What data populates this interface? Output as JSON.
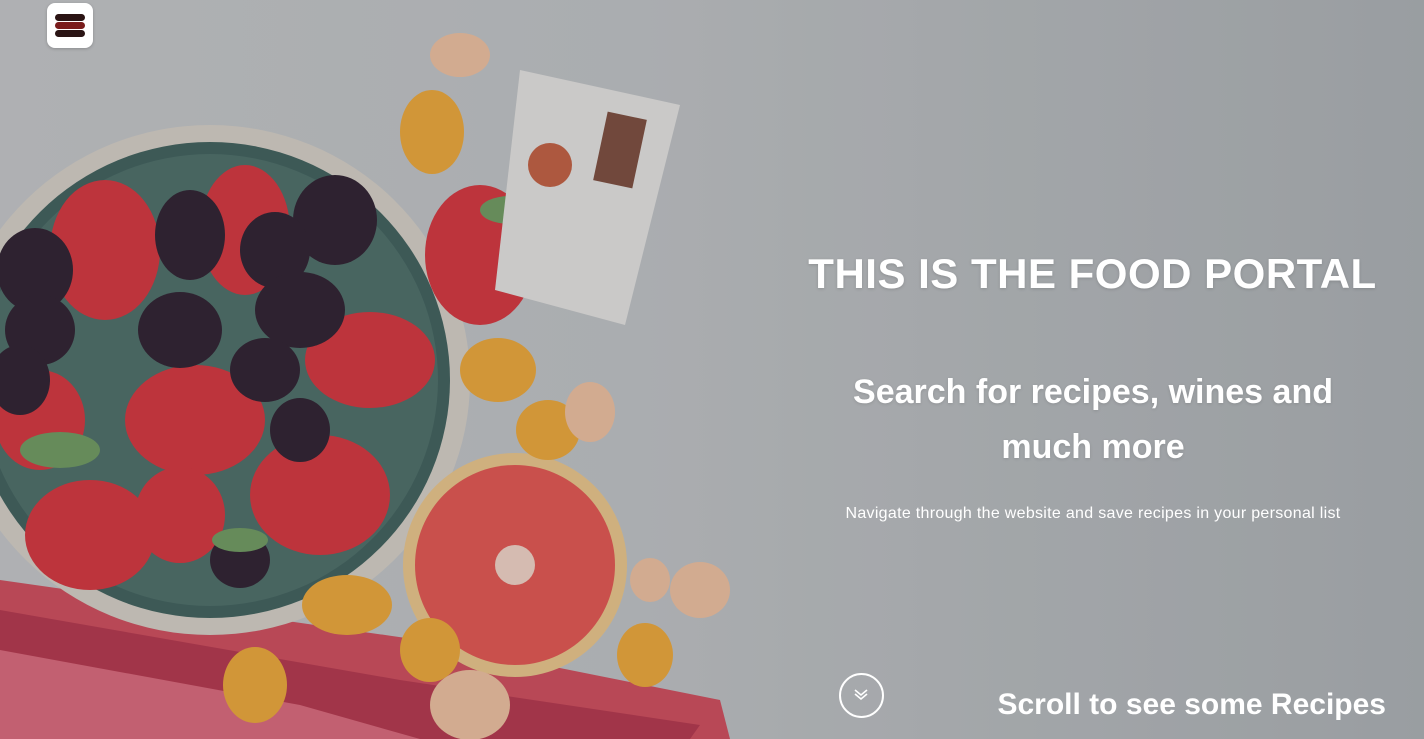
{
  "header": {
    "menu_icon": "hamburger-menu-icon"
  },
  "hero": {
    "title": "THIS IS THE FOOD PORTAL",
    "subtitle": "Search for recipes, wines and much more",
    "tagline": "Navigate through the website and save recipes in your personal list",
    "scroll_icon": "double-chevron-down-icon",
    "scroll_label": "Scroll to see some Recipes"
  },
  "colors": {
    "text": "#ffffff",
    "menu_bar_dark": "#2a1414",
    "menu_bar_accent": "#7a1c1c"
  }
}
